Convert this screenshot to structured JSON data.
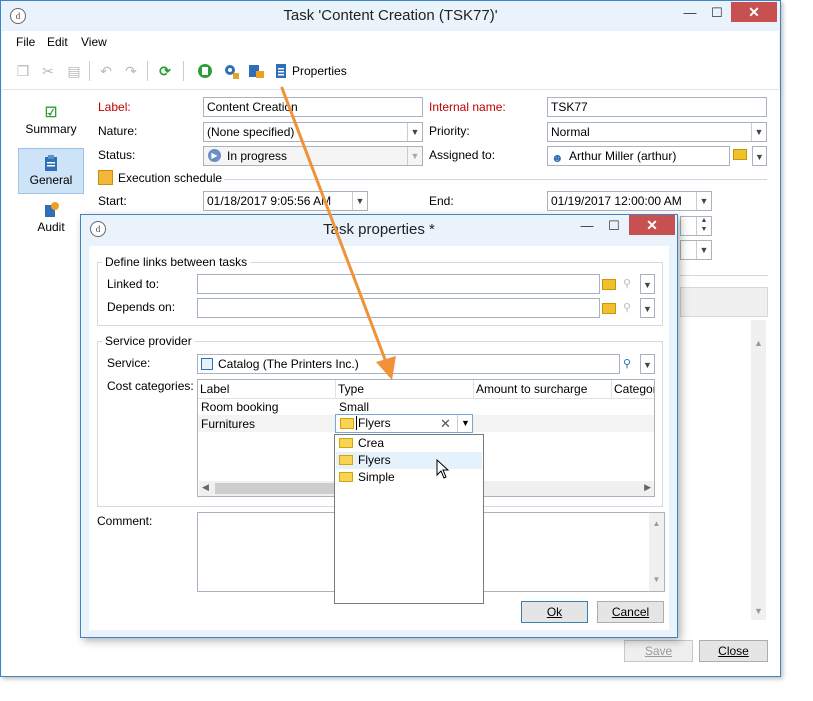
{
  "main_window": {
    "title": "Task 'Content Creation (TSK77)'",
    "menu": [
      "File",
      "Edit",
      "View"
    ],
    "toolbar": {
      "properties_label": "Properties"
    },
    "nav": [
      {
        "label": "Summary",
        "icon": "check-icon"
      },
      {
        "label": "General",
        "icon": "clipboard-icon",
        "selected": true
      },
      {
        "label": "Audit",
        "icon": "audit-icon"
      }
    ],
    "form": {
      "label_label": "Label:",
      "label_value": "Content Creation",
      "internal_name_label": "Internal name:",
      "internal_name_value": "TSK77",
      "nature_label": "Nature:",
      "nature_value": "(None specified)",
      "priority_label": "Priority:",
      "priority_value": "Normal",
      "status_label": "Status:",
      "status_value": "In progress",
      "assigned_label": "Assigned to:",
      "assigned_value": "Arthur Miller (arthur)",
      "schedule_label": "Execution schedule",
      "start_label": "Start:",
      "start_value": "01/18/2017 9:05:56 AM",
      "end_label": "End:",
      "end_value": "01/19/2017 12:00:00 AM"
    },
    "buttons": {
      "save": "Save",
      "close": "Close"
    }
  },
  "dialog": {
    "title": "Task properties *",
    "links_group": "Define links between tasks",
    "linked_to_label": "Linked to:",
    "depends_on_label": "Depends on:",
    "provider_group": "Service provider",
    "service_label": "Service:",
    "service_value": "Catalog (The Printers Inc.)",
    "cost_label": "Cost categories:",
    "columns": [
      "Label",
      "Type",
      "Amount to surcharge",
      "Categor"
    ],
    "rows": [
      {
        "label": "Room booking",
        "type": "Small"
      },
      {
        "label": "Furnitures",
        "type": "Flyers"
      }
    ],
    "dropdown_options": [
      "Crea",
      "Flyers",
      "Simple"
    ],
    "comment_label": "Comment:",
    "buttons": {
      "ok": "Ok",
      "cancel": "Cancel"
    }
  },
  "colors": {
    "accent": "#3d86c6",
    "arrow": "#f0923a",
    "close": "#c75050",
    "required": "#c00000"
  }
}
